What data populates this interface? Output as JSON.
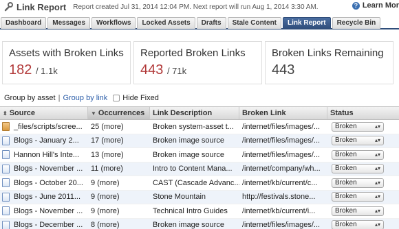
{
  "header": {
    "title": "Link Report",
    "subtitle": "Report created Jul 31, 2014 12:04 PM. Next report will run Aug 1, 2014 3:30 AM.",
    "learn_more": "Learn Mor"
  },
  "tabs": [
    "Dashboard",
    "Messages",
    "Workflows",
    "Locked Assets",
    "Drafts",
    "Stale Content",
    "Link Report",
    "Recycle Bin"
  ],
  "active_tab": "Link Report",
  "stats": [
    {
      "label": "Assets with Broken Links",
      "value": "182",
      "total": "/ 1.1k",
      "color": "#b23a3a"
    },
    {
      "label": "Reported Broken Links",
      "value": "443",
      "total": "/ 71k",
      "color": "#b23a3a"
    },
    {
      "label": "Broken Links Remaining",
      "value": "443",
      "total": "",
      "color": "#444444"
    }
  ],
  "groupby": {
    "asset": "Group by asset",
    "sep": "|",
    "link": "Group by link",
    "hide_fixed": "Hide Fixed"
  },
  "table": {
    "columns": [
      "Source",
      "Occurrences",
      "Link Description",
      "Broken Link",
      "Status"
    ],
    "rows": [
      {
        "icon": "script-file-icon",
        "source": "_files/scripts/scree...",
        "occ": "25 (more)",
        "desc": "Broken system-asset t...",
        "link": "/internet/files/images/...",
        "status": "Broken"
      },
      {
        "icon": "page-icon",
        "source": "Blogs - January 2...",
        "occ": "17 (more)",
        "desc": "Broken image source",
        "link": "/internet/files/images/...",
        "status": "Broken"
      },
      {
        "icon": "page-icon",
        "source": "Hannon Hill's Inte...",
        "occ": "13 (more)",
        "desc": "Broken image source",
        "link": "/internet/files/images/...",
        "status": "Broken"
      },
      {
        "icon": "page-icon",
        "source": "Blogs - November ...",
        "occ": "11 (more)",
        "desc": "Intro to Content Mana...",
        "link": "/internet/company/wh...",
        "status": "Broken"
      },
      {
        "icon": "page-icon",
        "source": "Blogs - October 20...",
        "occ": "9 (more)",
        "desc": "CAST (Cascade Advanc...",
        "link": "/internet/kb/current/c...",
        "status": "Broken"
      },
      {
        "icon": "page-icon",
        "source": "Blogs - June 2011...",
        "occ": "9 (more)",
        "desc": "Stone Mountain",
        "link": "http://festivals.stone...",
        "status": "Broken"
      },
      {
        "icon": "page-icon",
        "source": "Blogs - November ...",
        "occ": "9 (more)",
        "desc": "Technical Intro Guides",
        "link": "/internet/kb/current/i...",
        "status": "Broken"
      },
      {
        "icon": "page-icon",
        "source": "Blogs - December ...",
        "occ": "8 (more)",
        "desc": "Broken image source",
        "link": "/internet/files/images/...",
        "status": "Broken"
      }
    ]
  }
}
